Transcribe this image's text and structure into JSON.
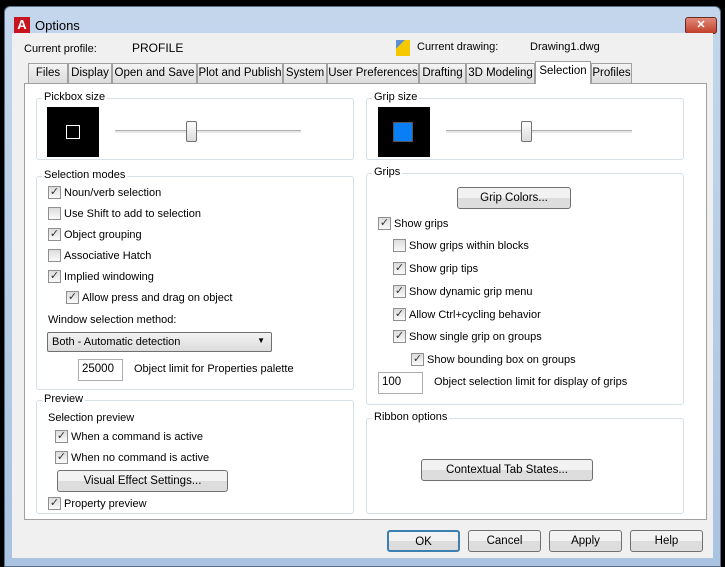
{
  "window": {
    "title": "Options",
    "close": "✕"
  },
  "header": {
    "profile_label": "Current profile:",
    "profile_value": "PROFILE",
    "drawing_label": "Current drawing:",
    "drawing_value": "Drawing1.dwg"
  },
  "tabs": [
    "Files",
    "Display",
    "Open and Save",
    "Plot and Publish",
    "System",
    "User Preferences",
    "Drafting",
    "3D Modeling",
    "Selection",
    "Profiles"
  ],
  "active_tab": "Selection",
  "pickbox": {
    "label": "Pickbox size",
    "slider": 0.41
  },
  "grip_size": {
    "label": "Grip size",
    "slider": 0.43,
    "color": "#0a7ff5"
  },
  "selection_modes": {
    "label": "Selection modes",
    "items": [
      {
        "label": "Noun/verb selection",
        "checked": true
      },
      {
        "label": "Use Shift to add to selection",
        "checked": false
      },
      {
        "label": "Object grouping",
        "checked": true
      },
      {
        "label": "Associative Hatch",
        "checked": false
      },
      {
        "label": "Implied windowing",
        "checked": true
      },
      {
        "label": "Allow press and drag on object",
        "checked": true
      }
    ],
    "window_method_label": "Window selection method:",
    "window_method_value": "Both - Automatic detection",
    "object_limit_value": "25000",
    "object_limit_label": "Object limit for Properties palette"
  },
  "preview": {
    "label": "Preview",
    "sub_label": "Selection preview",
    "items": [
      {
        "label": "When a command is active",
        "checked": true
      },
      {
        "label": "When no command is active",
        "checked": true
      }
    ],
    "visual_button": "Visual Effect Settings...",
    "property_preview": {
      "label": "Property preview",
      "checked": true
    }
  },
  "grips": {
    "label": "Grips",
    "colors_button": "Grip Colors...",
    "items": [
      {
        "label": "Show grips",
        "checked": true
      },
      {
        "label": "Show grips within blocks",
        "checked": false
      },
      {
        "label": "Show grip tips",
        "checked": true
      },
      {
        "label": "Show dynamic grip menu",
        "checked": true
      },
      {
        "label": "Allow Ctrl+cycling behavior",
        "checked": true
      },
      {
        "label": "Show single grip on groups",
        "checked": true
      },
      {
        "label": "Show bounding box on groups",
        "checked": true
      }
    ],
    "limit_value": "100",
    "limit_label": "Object selection limit for display of grips"
  },
  "ribbon": {
    "label": "Ribbon options",
    "button": "Contextual Tab States..."
  },
  "footer": {
    "ok": "OK",
    "cancel": "Cancel",
    "apply": "Apply",
    "help": "Help"
  }
}
